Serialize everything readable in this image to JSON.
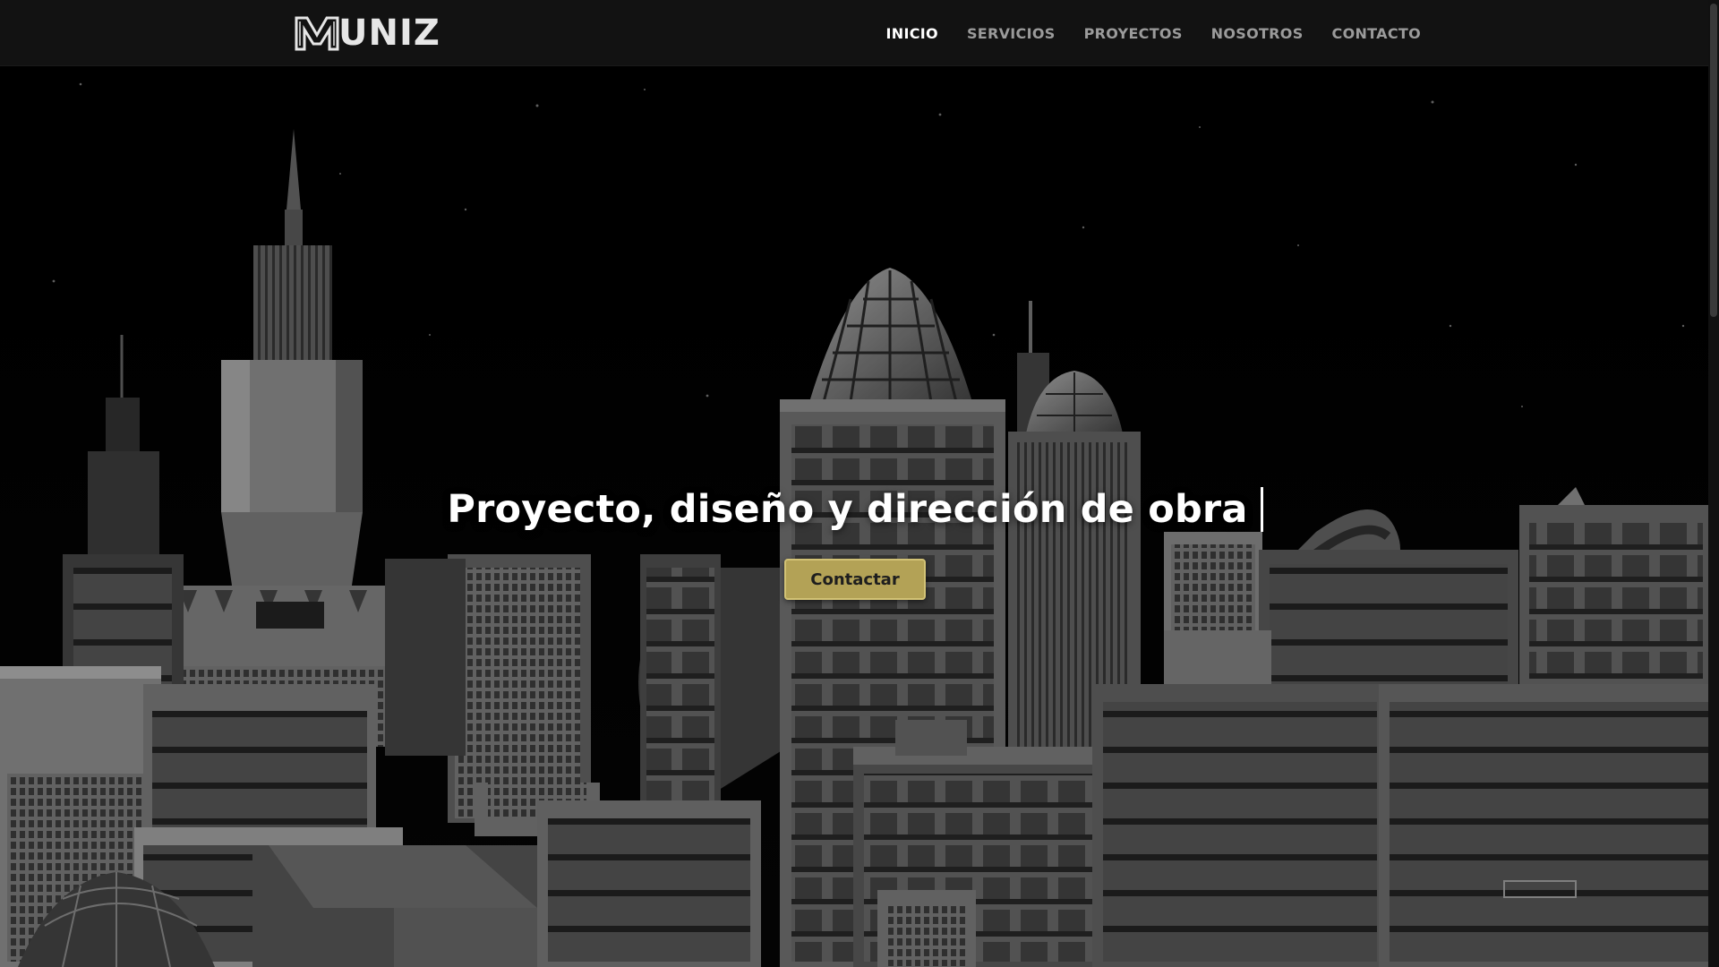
{
  "brand": {
    "logo_text": "UNIZ",
    "logo_mark": "M"
  },
  "nav": {
    "items": [
      {
        "label": "INICIO",
        "active": true
      },
      {
        "label": "SERVICIOS",
        "active": false
      },
      {
        "label": "PROYECTOS",
        "active": false
      },
      {
        "label": "NOSOTROS",
        "active": false
      },
      {
        "label": "CONTACTO",
        "active": false
      }
    ]
  },
  "hero": {
    "heading": "Proyecto, diseño y dirección de obra",
    "cta_label": "Contactar"
  },
  "colors": {
    "navbar_bg": "#121212",
    "accent_gold": "#b3a256",
    "nav_active": "#ffffff",
    "nav_inactive": "#9b9b9b"
  },
  "icons": {
    "logo": "muniz-m-logo-icon"
  }
}
